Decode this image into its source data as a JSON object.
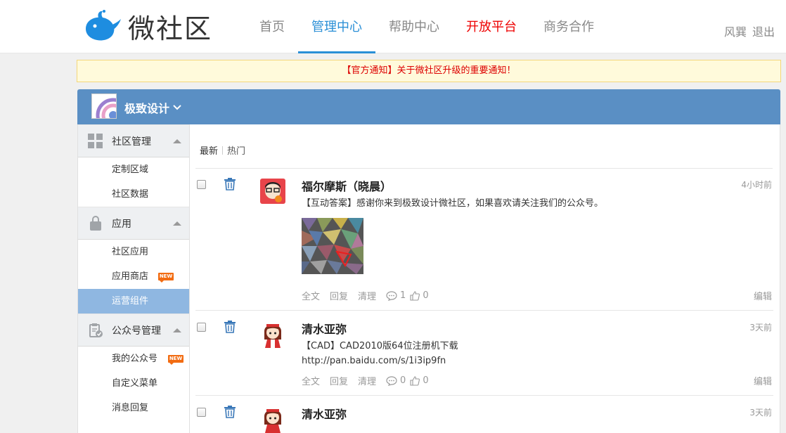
{
  "brand": {
    "name": "微社区"
  },
  "nav": [
    {
      "label": "首页"
    },
    {
      "label": "管理中心",
      "active": true
    },
    {
      "label": "帮助中心"
    },
    {
      "label": "开放平台",
      "highlight": "#e00000"
    },
    {
      "label": "商务合作"
    }
  ],
  "user": {
    "name": "风巽",
    "logout": "退出"
  },
  "notice": {
    "text": "【官方通知】关于微社区升级的重要通知！"
  },
  "community": {
    "name": "极致设计"
  },
  "sidebar": {
    "sections": [
      {
        "label": "社区管理",
        "icon": "grid-icon",
        "items": [
          {
            "label": "定制区域"
          },
          {
            "label": "社区数据"
          }
        ]
      },
      {
        "label": "应用",
        "icon": "bag-icon",
        "items": [
          {
            "label": "社区应用"
          },
          {
            "label": "应用商店",
            "badge": "NEW"
          },
          {
            "label": "运营组件",
            "active": true
          }
        ]
      },
      {
        "label": "公众号管理",
        "icon": "clipboard-icon",
        "items": [
          {
            "label": "我的公众号",
            "badge": "NEW"
          },
          {
            "label": "自定义菜单"
          },
          {
            "label": "消息回复"
          }
        ]
      }
    ]
  },
  "tabs": {
    "latest": "最新",
    "hot": "热门"
  },
  "posts": [
    {
      "author": "福尔摩斯（晓晨）",
      "time": "4小时前",
      "lines": [
        "【互动答案】感谢你来到极致设计微社区，如果喜欢请关注我们的公众号。"
      ],
      "actions": {
        "full": "全文",
        "reply": "回复",
        "clean": "清理",
        "comments": "1",
        "likes": "0",
        "edit": "编辑"
      }
    },
    {
      "author": "清水亚弥",
      "time": "3天前",
      "lines": [
        "【CAD】CAD2010版64位注册机下载",
        "http://pan.baidu.com/s/1i3ip9fn"
      ],
      "actions": {
        "full": "全文",
        "reply": "回复",
        "clean": "清理",
        "comments": "0",
        "likes": "0",
        "edit": "编辑"
      }
    },
    {
      "author": "清水亚弥",
      "time": "3天前"
    }
  ],
  "colors": {
    "accent": "#2a8fd6",
    "community_bar": "#5a8fc4",
    "sidebar_active": "#8fb7e1",
    "notice_text": "#dd0000"
  }
}
